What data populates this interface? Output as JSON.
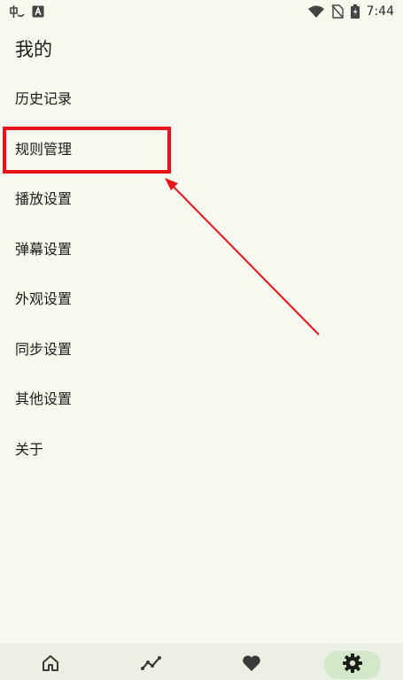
{
  "status_bar": {
    "left_icons": [
      "app-notification-icon",
      "a-badge-icon"
    ],
    "right_icons": [
      "wifi-icon",
      "no-sim-icon",
      "battery-charging-icon"
    ],
    "time": "7:44"
  },
  "page": {
    "title": "我的"
  },
  "menu": {
    "items": [
      {
        "label": "历史记录"
      },
      {
        "label": "规则管理"
      },
      {
        "label": "播放设置"
      },
      {
        "label": "弹幕设置"
      },
      {
        "label": "外观设置"
      },
      {
        "label": "同步设置"
      },
      {
        "label": "其他设置"
      },
      {
        "label": "关于"
      }
    ]
  },
  "annotation": {
    "highlight_color": "#e8141a",
    "arrow_color": "#e8141a",
    "highlighted_item": "规则管理"
  },
  "bottom_nav": {
    "items": [
      {
        "icon": "home-icon",
        "active": false
      },
      {
        "icon": "trending-icon",
        "active": false
      },
      {
        "icon": "heart-icon",
        "active": false
      },
      {
        "icon": "settings-gear-icon",
        "active": true
      }
    ],
    "active_color": "#d3e8c9"
  }
}
